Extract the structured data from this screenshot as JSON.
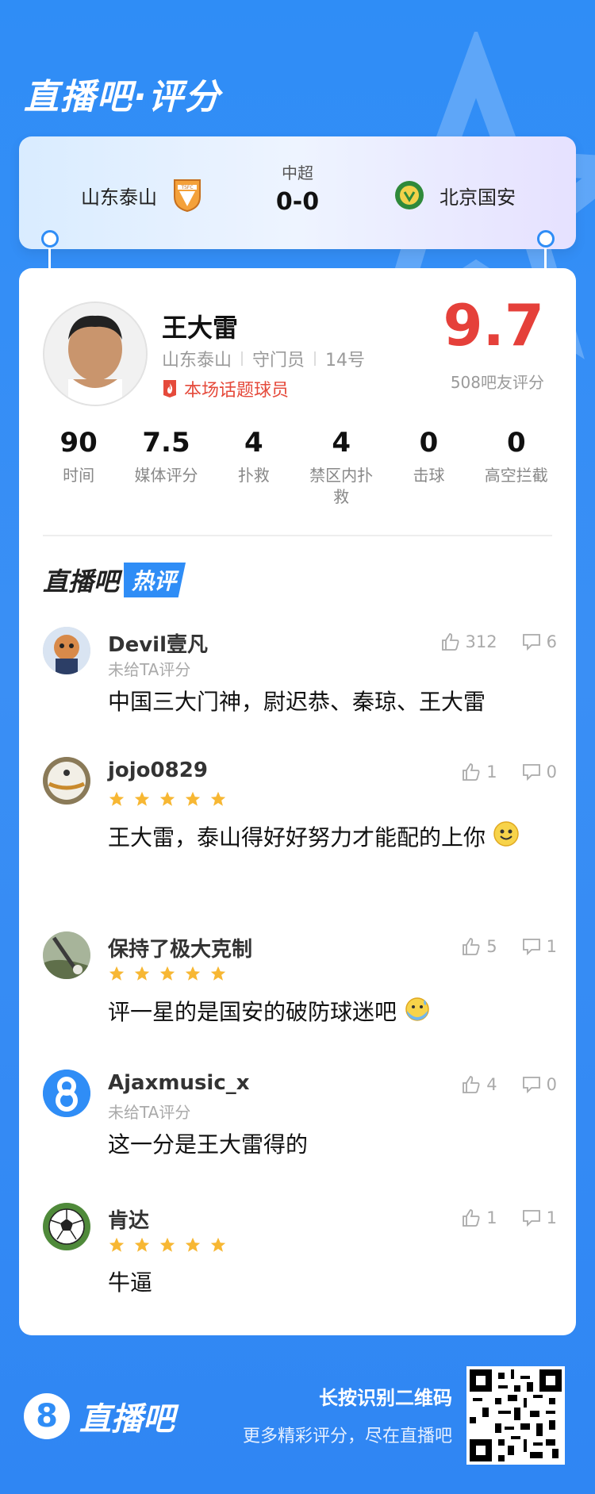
{
  "brand": {
    "title": "直播吧·评分"
  },
  "match": {
    "home": "山东泰山",
    "away": "北京国安",
    "league": "中超",
    "score": "0-0"
  },
  "player": {
    "name": "王大雷",
    "team": "山东泰山",
    "position": "守门员",
    "number": "14号",
    "tag": "本场话题球员",
    "score": "9.7",
    "score_count": "508吧友评分"
  },
  "stats": [
    {
      "value": "90",
      "label": "时间"
    },
    {
      "value": "7.5",
      "label": "媒体评分"
    },
    {
      "value": "4",
      "label": "扑救"
    },
    {
      "value": "4",
      "label": "禁区内扑救"
    },
    {
      "value": "0",
      "label": "击球"
    },
    {
      "value": "0",
      "label": "高空拦截"
    }
  ],
  "hot": {
    "title_left": "直播吧",
    "title_right": "热评"
  },
  "comments": [
    {
      "user": "Devil壹凡",
      "sub": "未给TA评分",
      "text": "中国三大门神，尉迟恭、秦琼、王大雷",
      "likes": "312",
      "replies": "6",
      "stars": 0
    },
    {
      "user": "jojo0829",
      "sub": "",
      "text": "王大雷，泰山得好好努力才能配的上你",
      "likes": "1",
      "replies": "0",
      "stars": 5
    },
    {
      "user": "保持了极大克制",
      "sub": "",
      "text": "评一星的是国安的破防球迷吧",
      "likes": "5",
      "replies": "1",
      "stars": 5
    },
    {
      "user": "Ajaxmusic_x",
      "sub": "未给TA评分",
      "text": "这一分是王大雷得的",
      "likes": "4",
      "replies": "0",
      "stars": 0
    },
    {
      "user": "肯达",
      "sub": "",
      "text": "牛逼",
      "likes": "1",
      "replies": "1",
      "stars": 5
    }
  ],
  "footer": {
    "logo_text": "直播吧",
    "title": "长按识别二维码",
    "subtitle": "更多精彩评分，尽在直播吧"
  },
  "colors": {
    "primary": "#2f8df6",
    "score": "#e5403a",
    "star": "#f7b733"
  }
}
